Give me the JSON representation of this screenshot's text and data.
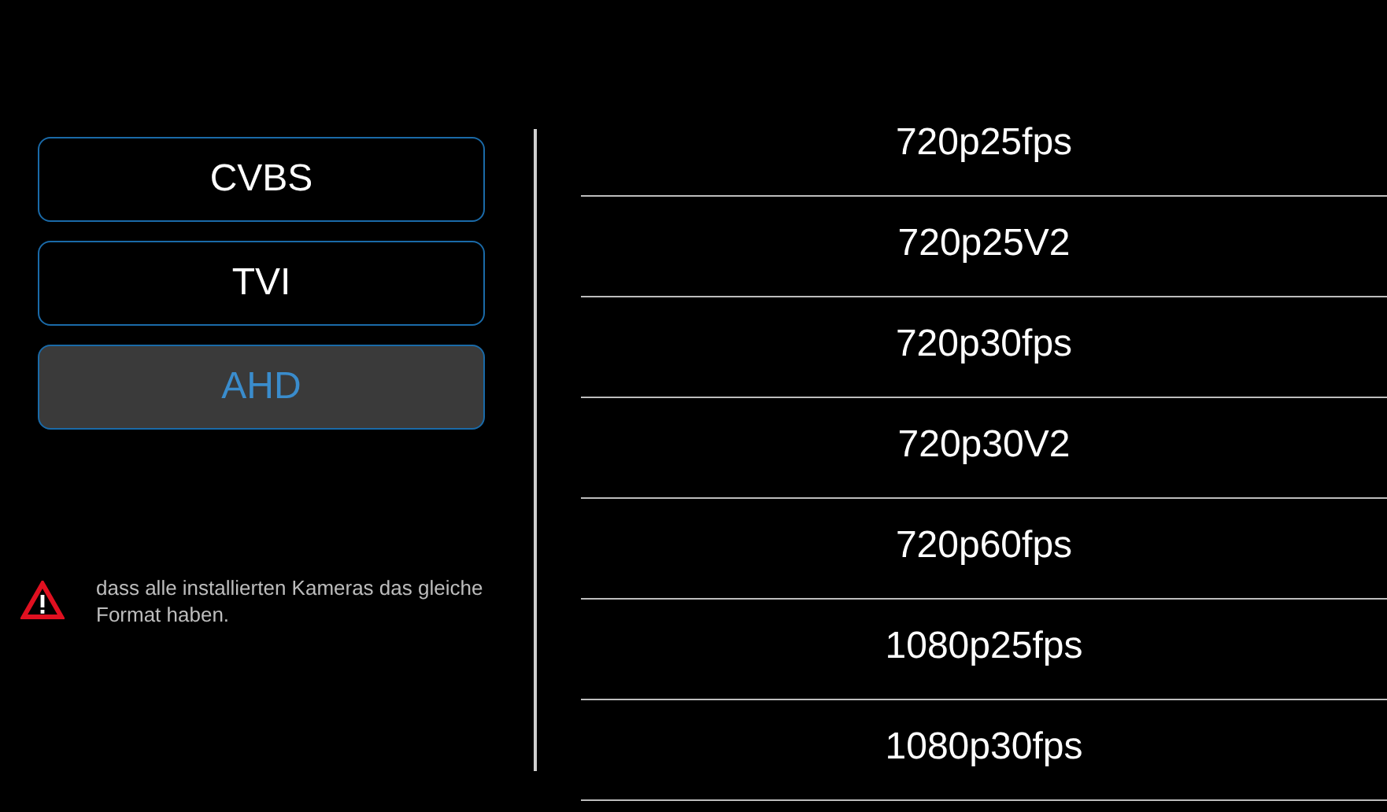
{
  "signal_types": [
    {
      "label": "CVBS",
      "selected": false
    },
    {
      "label": "TVI",
      "selected": false
    },
    {
      "label": "AHD",
      "selected": true
    }
  ],
  "warning": {
    "text": "dass alle installierten Kameras das gleiche Format haben."
  },
  "formats": [
    "720p25fps",
    "720p25V2",
    "720p30fps",
    "720p30V2",
    "720p60fps",
    "1080p25fps",
    "1080p30fps"
  ]
}
